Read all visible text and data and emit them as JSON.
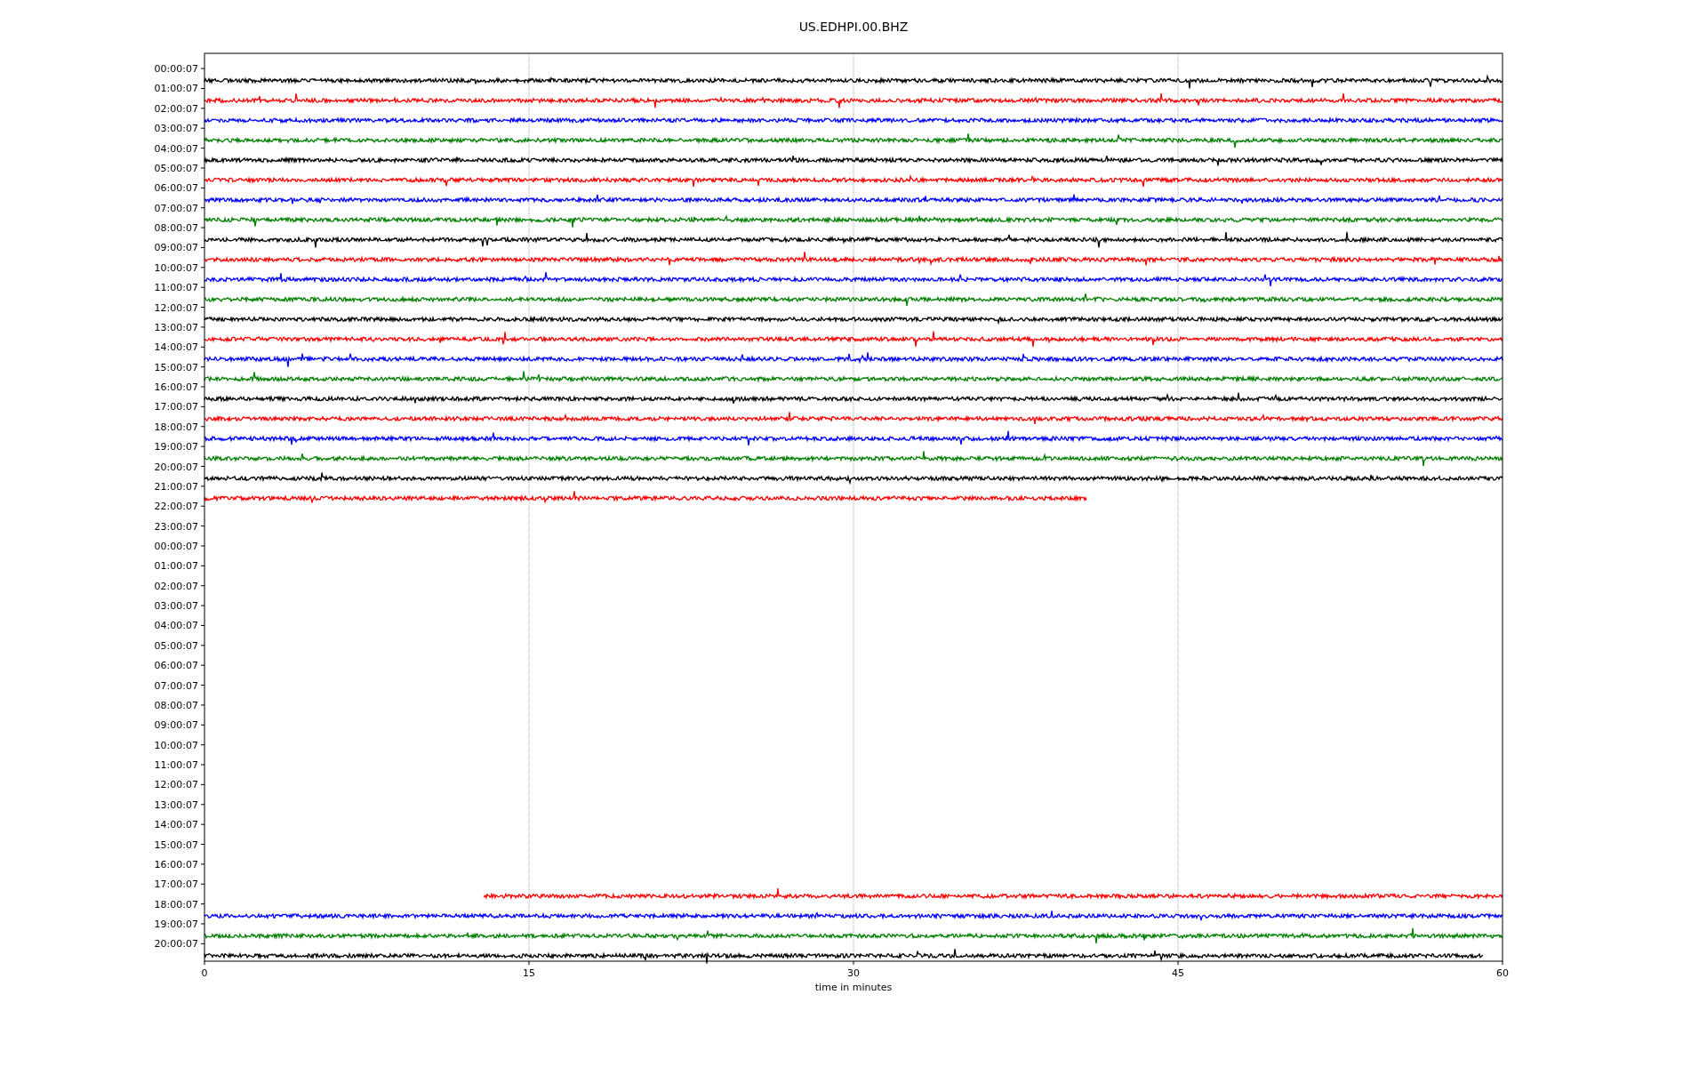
{
  "title": "US.EDHPI.00.BHZ",
  "rows": [
    {
      "label": "00:00:07",
      "trace": {
        "color": "#000000",
        "kind": "head",
        "level": 1
      }
    },
    {
      "label": "01:00:07",
      "trace": {
        "color": "#ff0000",
        "kind": "head",
        "level": 1
      }
    },
    {
      "label": "02:00:07",
      "trace": {
        "color": "#0000ff",
        "kind": "head",
        "level": 1
      }
    },
    {
      "label": "03:00:07",
      "trace": {
        "color": "#008000",
        "kind": "head",
        "level": 1
      }
    },
    {
      "label": "04:00:07",
      "trace": {
        "color": "#000000",
        "kind": "head",
        "level": 1
      }
    },
    {
      "label": "05:00:07",
      "trace": {
        "color": "#ff0000",
        "kind": "head",
        "level": 1
      }
    },
    {
      "label": "06:00:07",
      "trace": {
        "color": "#0000ff",
        "kind": "head",
        "level": 1
      }
    },
    {
      "label": "07:00:07",
      "trace": {
        "color": "#008000",
        "kind": "head",
        "level": 1
      }
    },
    {
      "label": "08:00:07",
      "trace": {
        "color": "#000000",
        "kind": "head",
        "level": 1
      }
    },
    {
      "label": "09:00:07",
      "trace": {
        "color": "#ff0000",
        "kind": "head",
        "level": 1
      }
    },
    {
      "label": "10:00:07",
      "trace": {
        "color": "#0000ff",
        "kind": "head",
        "level": 1
      }
    },
    {
      "label": "11:00:07",
      "trace": {
        "color": "#008000",
        "kind": "head",
        "level": 1
      }
    },
    {
      "label": "12:00:07",
      "trace": {
        "color": "#000000",
        "kind": "head",
        "level": 1
      }
    },
    {
      "label": "13:00:07",
      "trace": {
        "color": "#ff0000",
        "kind": "head",
        "level": 1
      }
    },
    {
      "label": "14:00:07",
      "trace": {
        "color": "#0000ff",
        "kind": "head",
        "level": 1
      }
    },
    {
      "label": "15:00:07",
      "trace": {
        "color": "#008000",
        "kind": "head",
        "level": 1
      }
    },
    {
      "label": "16:00:07",
      "trace": {
        "color": "#000000",
        "kind": "head",
        "level": 1
      }
    },
    {
      "label": "17:00:07",
      "trace": {
        "color": "#ff0000",
        "kind": "head",
        "level": 1
      }
    },
    {
      "label": "18:00:07",
      "trace": {
        "color": "#0000ff",
        "kind": "head",
        "level": 1
      }
    },
    {
      "label": "19:00:07",
      "trace": {
        "color": "#008000",
        "kind": "head",
        "level": 1
      }
    },
    {
      "label": "20:00:07",
      "trace": {
        "color": "#000000",
        "kind": "head",
        "level": 1
      }
    },
    {
      "label": "21:00:07",
      "trace": {
        "color": "#ff0000",
        "kind": "head",
        "level": 0.68
      }
    },
    {
      "label": "22:00:07"
    },
    {
      "label": "23:00:07"
    },
    {
      "label": "00:00:07"
    },
    {
      "label": "01:00:07"
    },
    {
      "label": "02:00:07"
    },
    {
      "label": "03:00:07"
    },
    {
      "label": "04:00:07"
    },
    {
      "label": "05:00:07"
    },
    {
      "label": "06:00:07"
    },
    {
      "label": "07:00:07"
    },
    {
      "label": "08:00:07"
    },
    {
      "label": "09:00:07"
    },
    {
      "label": "10:00:07"
    },
    {
      "label": "11:00:07"
    },
    {
      "label": "12:00:07"
    },
    {
      "label": "13:00:07"
    },
    {
      "label": "14:00:07"
    },
    {
      "label": "15:00:07"
    },
    {
      "label": "16:00:07"
    },
    {
      "label": "17:00:07",
      "trace": {
        "color": "#ff0000",
        "kind": "tail",
        "level": 0.785
      }
    },
    {
      "label": "18:00:07",
      "trace": {
        "color": "#0000ff",
        "kind": "head",
        "level": 1
      }
    },
    {
      "label": "19:00:07",
      "trace": {
        "color": "#008000",
        "kind": "head",
        "level": 1
      }
    },
    {
      "label": "20:00:07",
      "trace": {
        "color": "#000000",
        "kind": "head",
        "level": 0.985
      }
    }
  ],
  "x_axis": {
    "ticks": [
      "0",
      "15",
      "30",
      "45",
      "60"
    ],
    "label": "time in minutes"
  }
}
